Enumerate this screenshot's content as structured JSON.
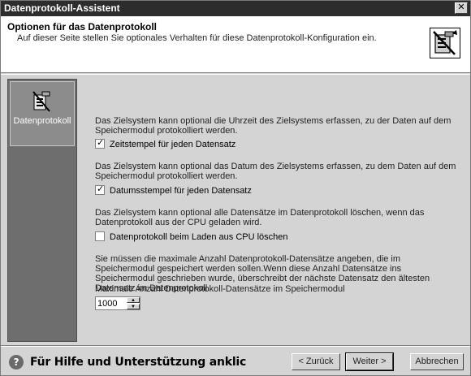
{
  "window": {
    "title": "Datenprotokoll-Assistent",
    "close_glyph": "✕"
  },
  "header": {
    "title": "Optionen für das Datenprotokoll",
    "subtitle": "Auf dieser Seite stellen Sie optionales Verhalten für diese Datenprotokoll-Konfiguration ein.",
    "icon": "datalog-wizard-icon"
  },
  "sidebar": {
    "items": [
      {
        "label": "Datenprotokoll",
        "icon": "datalog-icon",
        "selected": true
      }
    ]
  },
  "main": {
    "para_time": "Das Zielsystem kann optional die Uhrzeit des Zielsystems erfassen, zu der Daten auf dem Speichermodul protokolliert werden.",
    "cb_timestamp": {
      "label": "Zeitstempel für jeden Datensatz",
      "checked": true
    },
    "para_date": "Das Zielsystem kann optional das Datum des Zielsystems erfassen, zu dem Daten auf dem Speichermodul protokolliert werden.",
    "cb_datestamp": {
      "label": "Datumsstempel für jeden Datensatz",
      "checked": true
    },
    "para_delete": "Das Zielsystem kann optional alle Datensätze im Datenprotokoll löschen, wenn das Datenprotokoll aus der CPU geladen wird.",
    "cb_delete": {
      "label": "Datenprotokoll beim Laden aus CPU löschen",
      "checked": false
    },
    "para_max": "Sie müssen die maximale Anzahl Datenprotokoll-Datensätze angeben, die im Speichermodul gespeichert werden sollen.Wenn diese Anzahl Datensätze ins Speichermodul geschrieben wurde, überschreibt der nächste Datensatz den ältesten Datensatz im Datenprotokoll.",
    "max_label": "Maximale Anzahl Datenprotokoll-Datensätze im Speichermodul",
    "max_value": "1000"
  },
  "footer": {
    "help_text": "Für Hilfe und Unterstützung anklic",
    "help_icon_glyph": "?",
    "back_label": "< Zurück",
    "next_label": "Weiter >",
    "cancel_label": "Abbrechen"
  }
}
